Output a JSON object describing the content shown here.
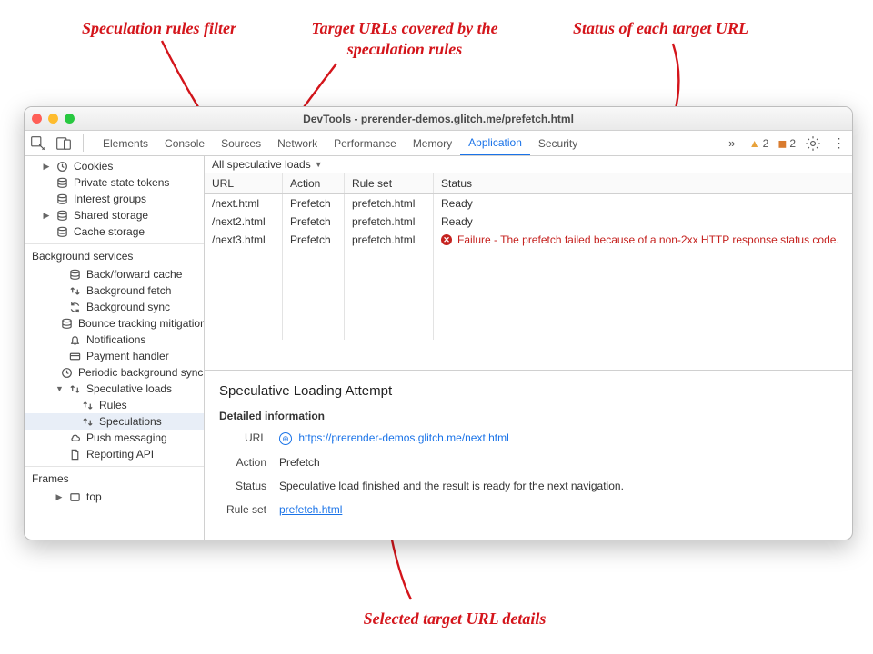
{
  "titlebar": {
    "title": "DevTools - prerender-demos.glitch.me/prefetch.html"
  },
  "tabs": {
    "items": [
      "Elements",
      "Console",
      "Sources",
      "Network",
      "Performance",
      "Memory",
      "Application",
      "Security"
    ],
    "active": "Application",
    "warnings_triangle": "2",
    "warnings_flag": "2"
  },
  "sidebar": {
    "app_group": [
      {
        "icon": "clock",
        "label": "Cookies",
        "exp": true
      },
      {
        "icon": "db",
        "label": "Private state tokens"
      },
      {
        "icon": "db",
        "label": "Interest groups"
      },
      {
        "icon": "db",
        "label": "Shared storage",
        "exp": true
      },
      {
        "icon": "db",
        "label": "Cache storage"
      }
    ],
    "bg_title": "Background services",
    "bg_group": [
      {
        "icon": "db",
        "label": "Back/forward cache"
      },
      {
        "icon": "ud",
        "label": "Background fetch"
      },
      {
        "icon": "sync",
        "label": "Background sync"
      },
      {
        "icon": "db",
        "label": "Bounce tracking mitigations"
      },
      {
        "icon": "bell",
        "label": "Notifications"
      },
      {
        "icon": "card",
        "label": "Payment handler"
      },
      {
        "icon": "clock",
        "label": "Periodic background sync"
      },
      {
        "icon": "ud",
        "label": "Speculative loads",
        "exp": true,
        "open": true,
        "children": [
          {
            "icon": "ud",
            "label": "Rules"
          },
          {
            "icon": "ud",
            "label": "Speculations",
            "selected": true
          }
        ]
      },
      {
        "icon": "cloud",
        "label": "Push messaging"
      },
      {
        "icon": "page",
        "label": "Reporting API"
      }
    ],
    "frames_title": "Frames",
    "frames_group": [
      {
        "icon": "frame",
        "label": "top",
        "exp": true
      }
    ]
  },
  "filter": {
    "label": "All speculative loads"
  },
  "columns": {
    "url": "URL",
    "action": "Action",
    "rule": "Rule set",
    "status": "Status"
  },
  "rows": [
    {
      "url": "/next.html",
      "action": "Prefetch",
      "rule": "prefetch.html",
      "status": "Ready",
      "fail": false
    },
    {
      "url": "/next2.html",
      "action": "Prefetch",
      "rule": "prefetch.html",
      "status": "Ready",
      "fail": false
    },
    {
      "url": "/next3.html",
      "action": "Prefetch",
      "rule": "prefetch.html",
      "status": "Failure - The prefetch failed because of a non-2xx HTTP response status code.",
      "fail": true
    }
  ],
  "detail": {
    "title": "Speculative Loading Attempt",
    "subtitle": "Detailed information",
    "url_label": "URL",
    "url_value": "https://prerender-demos.glitch.me/next.html",
    "action_label": "Action",
    "action_value": "Prefetch",
    "status_label": "Status",
    "status_value": "Speculative load finished and the result is ready for the next navigation.",
    "ruleset_label": "Rule set",
    "ruleset_value": "prefetch.html"
  },
  "annotations": {
    "a1": "Speculation rules filter",
    "a2": "Target URLs covered by\nthe speculation rules",
    "a3": "Status of each target URL",
    "a4": "Selected target URL details"
  }
}
